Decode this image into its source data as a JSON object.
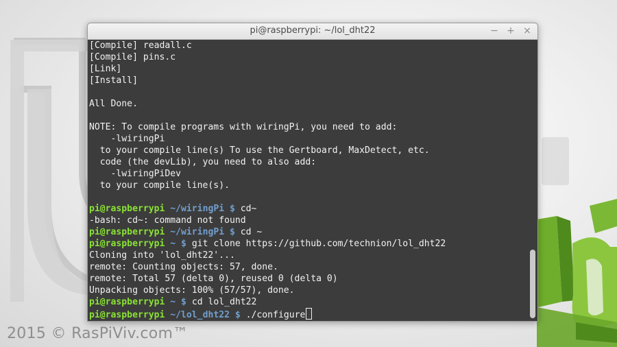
{
  "window": {
    "title": "pi@raspberrypi: ~/lol_dht22",
    "minimize_symbol": "−",
    "maximize_symbol": "+",
    "close_symbol": "×"
  },
  "watermark": "2015 © RasPiViv.com™",
  "terminal": {
    "lines": [
      {
        "text": "[Compile] readall.c"
      },
      {
        "text": "[Compile] pins.c"
      },
      {
        "text": "[Link]"
      },
      {
        "text": "[Install]"
      },
      {
        "text": ""
      },
      {
        "text": "All Done."
      },
      {
        "text": ""
      },
      {
        "text": "NOTE: To compile programs with wiringPi, you need to add:"
      },
      {
        "text": "    -lwiringPi"
      },
      {
        "text": "  to your compile line(s) To use the Gertboard, MaxDetect, etc."
      },
      {
        "text": "  code (the devLib), you need to also add:"
      },
      {
        "text": "    -lwiringPiDev"
      },
      {
        "text": "  to your compile line(s)."
      },
      {
        "text": ""
      },
      {
        "prompt_user": "pi@raspberrypi",
        "prompt_path": "~/wiringPi $",
        "command": "cd~"
      },
      {
        "text": "-bash: cd~: command not found"
      },
      {
        "prompt_user": "pi@raspberrypi",
        "prompt_path": "~/wiringPi $",
        "command": "cd ~"
      },
      {
        "prompt_user": "pi@raspberrypi",
        "prompt_path": "~ $",
        "command": "git clone https://github.com/technion/lol_dht22"
      },
      {
        "text": "Cloning into 'lol_dht22'..."
      },
      {
        "text": "remote: Counting objects: 57, done."
      },
      {
        "text": "remote: Total 57 (delta 0), reused 0 (delta 0)"
      },
      {
        "text": "Unpacking objects: 100% (57/57), done."
      },
      {
        "prompt_user": "pi@raspberrypi",
        "prompt_path": "~ $",
        "command": "cd lol_dht22"
      },
      {
        "prompt_user": "pi@raspberrypi",
        "prompt_path": "~/lol_dht22 $",
        "command": "./configure",
        "cursor": true
      }
    ]
  },
  "colors": {
    "terminal_bg": "#3c3c3c",
    "prompt_user": "#8ae234",
    "prompt_path": "#729fcf",
    "text": "#f2f2f2",
    "logo_green": "#8cc63f"
  },
  "icons": {
    "minimize": "minimize-icon",
    "maximize": "maximize-icon",
    "close": "close-icon",
    "wallpaper": "linux-mint-logo"
  }
}
